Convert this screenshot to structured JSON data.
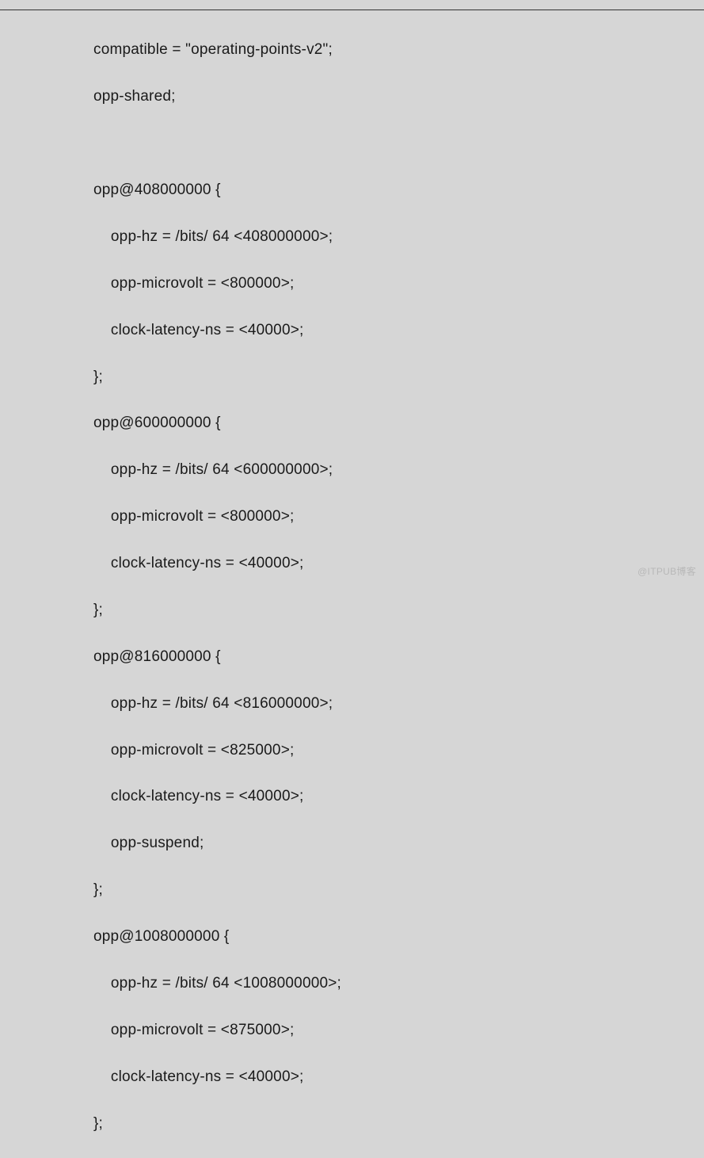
{
  "code": {
    "header": {
      "compatible_line": "compatible = \"operating-points-v2\";",
      "shared_line": "opp-shared;"
    },
    "opps": [
      {
        "open": "opp@408000000 {",
        "hz": "    opp-hz = /bits/ 64 <408000000>;",
        "uv": "    opp-microvolt = <800000>;",
        "lat": "    clock-latency-ns = <40000>;",
        "suspend": null,
        "close": "};"
      },
      {
        "open": "opp@600000000 {",
        "hz": "    opp-hz = /bits/ 64 <600000000>;",
        "uv": "    opp-microvolt = <800000>;",
        "lat": "    clock-latency-ns = <40000>;",
        "suspend": null,
        "close": "};"
      },
      {
        "open": "opp@816000000 {",
        "hz": "    opp-hz = /bits/ 64 <816000000>;",
        "uv": "    opp-microvolt = <825000>;",
        "lat": "    clock-latency-ns = <40000>;",
        "suspend": "    opp-suspend;",
        "close": "};"
      },
      {
        "open": "opp@1008000000 {",
        "hz": "    opp-hz = /bits/ 64 <1008000000>;",
        "uv": "    opp-microvolt = <875000>;",
        "lat": "    clock-latency-ns = <40000>;",
        "suspend": null,
        "close": "};"
      }
    ]
  },
  "watermark": "@ITPUB博客"
}
